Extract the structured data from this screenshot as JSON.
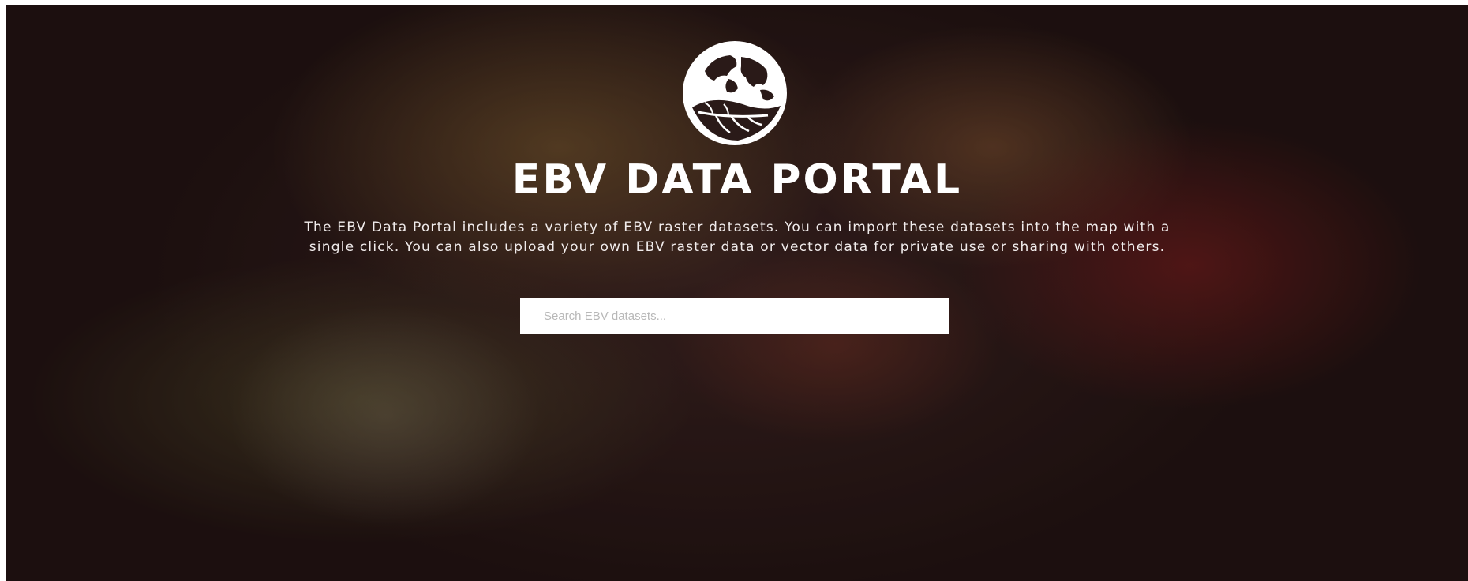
{
  "hero": {
    "title": "EBV DATA PORTAL",
    "description": "The EBV Data Portal includes a variety of EBV raster datasets. You can import these datasets into the map with a single click. You can also upload your own EBV raster data or vector data for private use or sharing with others.",
    "background_image": "chameleon-photo",
    "logo_icon": "globe-leaf-logo-icon"
  },
  "search": {
    "placeholder": "Search EBV datasets...",
    "value": ""
  },
  "colors": {
    "title": "#ffffff",
    "text": "#f1ecec",
    "search_bg": "#ffffff",
    "placeholder": "#b8b8b8"
  }
}
